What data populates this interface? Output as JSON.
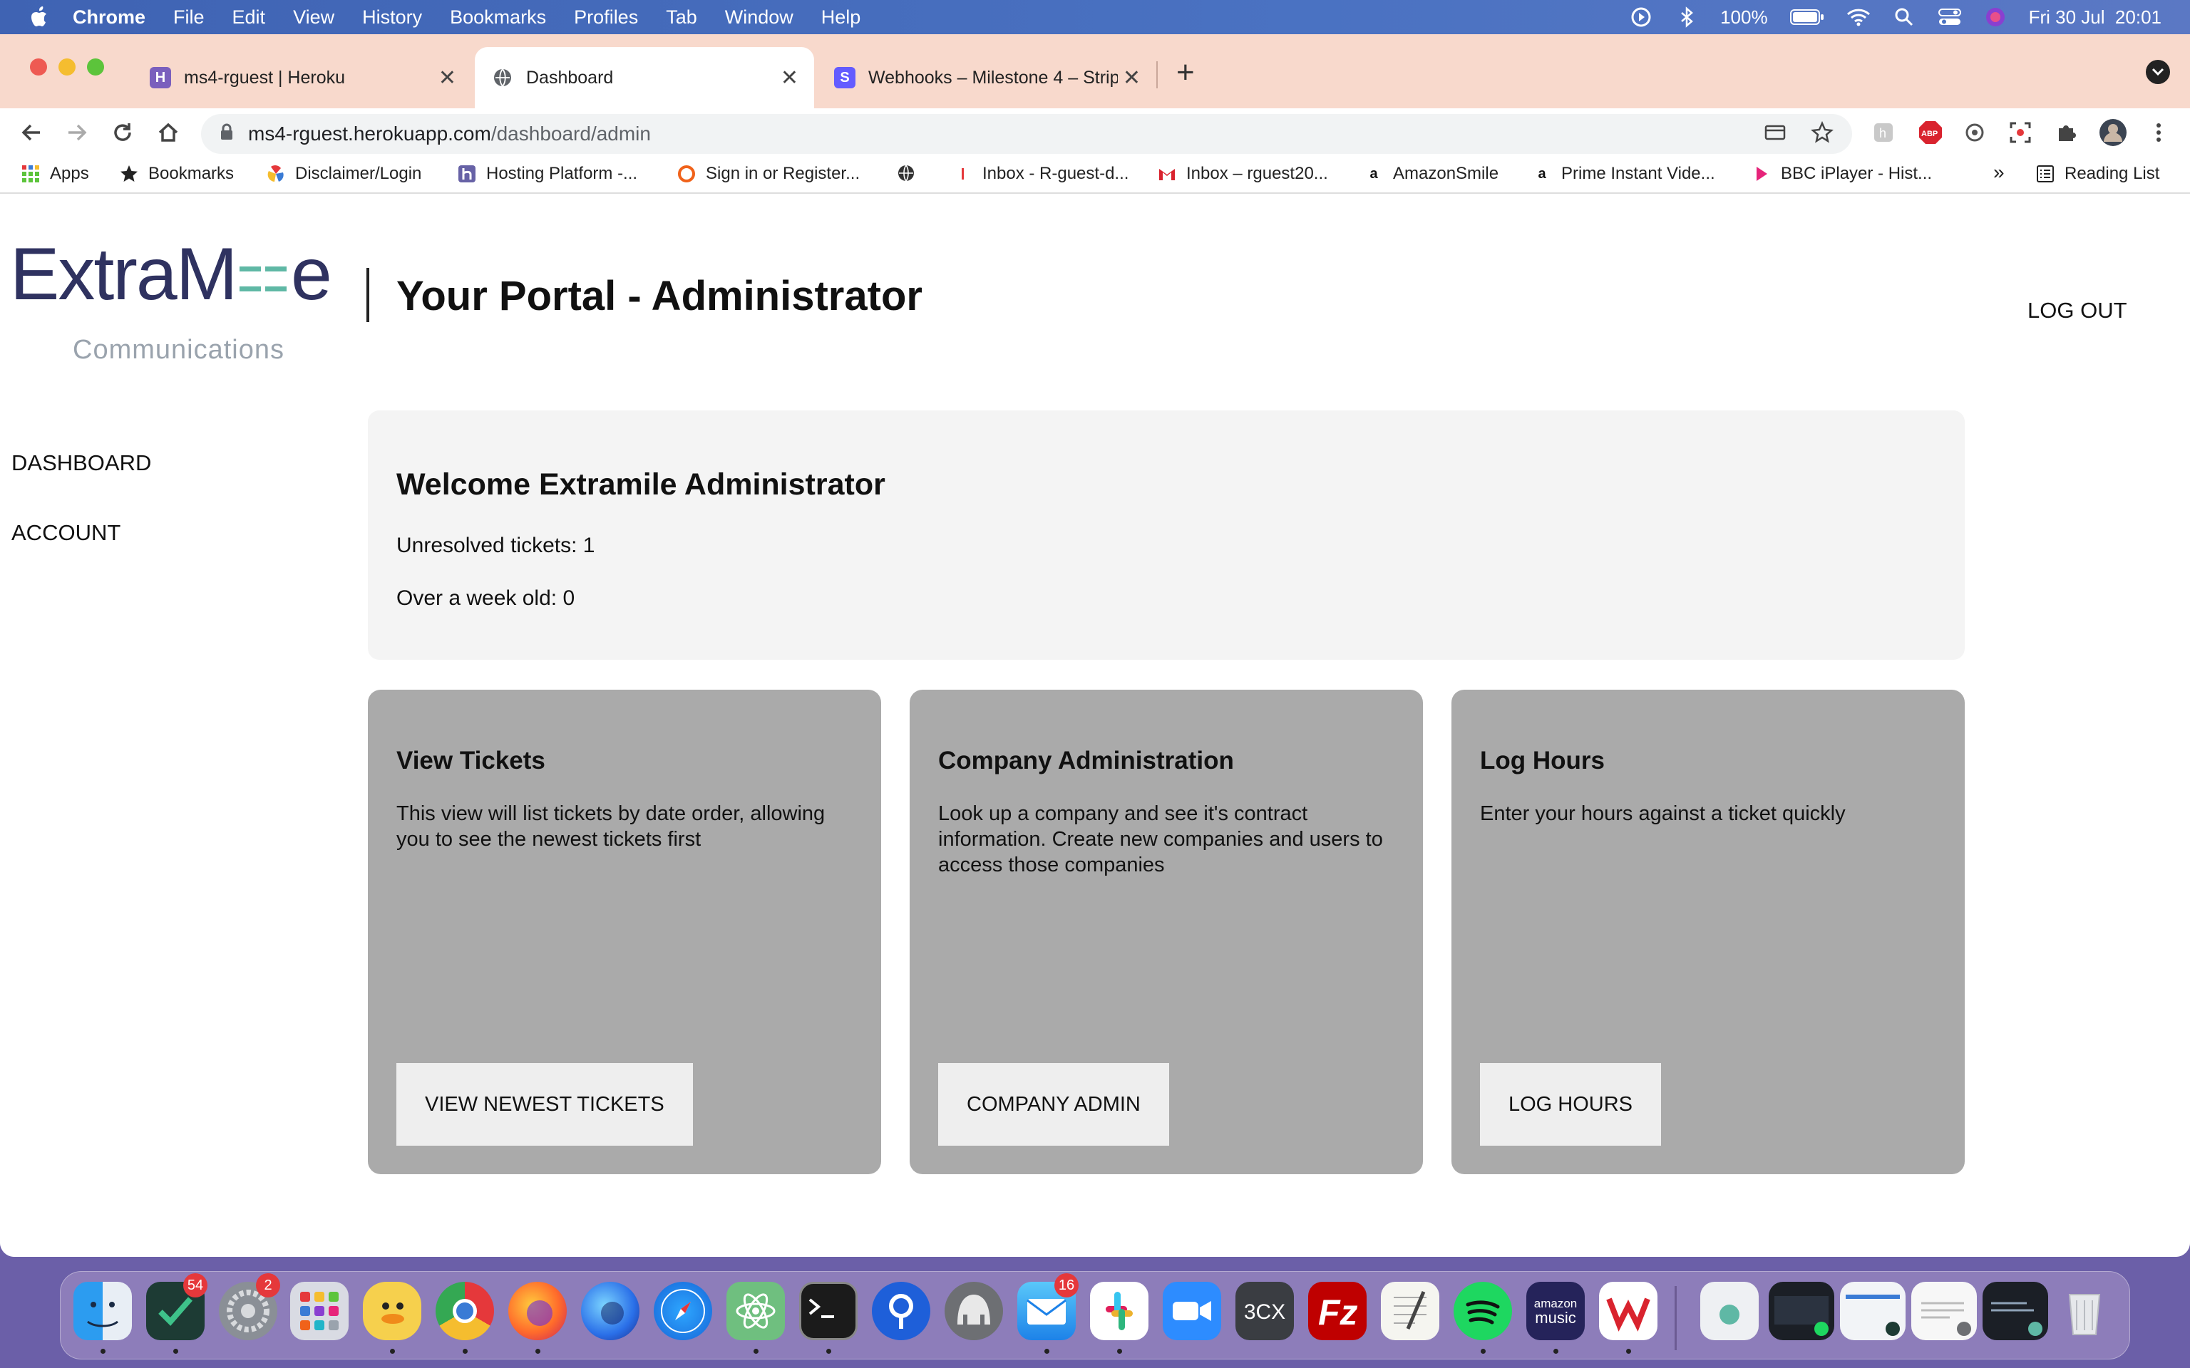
{
  "menubar": {
    "app": "Chrome",
    "items": [
      "File",
      "Edit",
      "View",
      "History",
      "Bookmarks",
      "Profiles",
      "Tab",
      "Window",
      "Help"
    ],
    "battery": "100%",
    "clock": "Fri 30 Jul  20:01"
  },
  "tabs": [
    {
      "title": "ms4-rguest | Heroku",
      "favicon": "H"
    },
    {
      "title": "Dashboard",
      "favicon": "globe"
    },
    {
      "title": "Webhooks – Milestone 4 – Strip",
      "favicon": "S"
    }
  ],
  "omnibox": {
    "host": "ms4-rguest.herokuapp.com",
    "path": "/dashboard/admin"
  },
  "bookmarks": {
    "items": [
      "Apps",
      "Bookmarks",
      "Disclaimer/Login",
      "Hosting Platform -...",
      "Sign in or Register...",
      "",
      "Inbox - R-guest-d...",
      "Inbox – rguest20...",
      "AmazonSmile",
      "Prime Instant Vide...",
      "BBC iPlayer - Hist..."
    ],
    "overflow": "»",
    "reading_list": "Reading List"
  },
  "page": {
    "logo_word": "ExtraM=e",
    "logo_sub": "Communications",
    "title": "Your Portal - Administrator",
    "logout": "LOG OUT",
    "nav": [
      "DASHBOARD",
      "ACCOUNT"
    ],
    "welcome": {
      "heading": "Welcome Extramile Administrator",
      "unresolved": "Unresolved tickets: 1",
      "week_old": "Over a week old: 0"
    },
    "cards": [
      {
        "title": "View Tickets",
        "text": "This view will list tickets by date order, allowing you to see the newest tickets first",
        "button": "VIEW NEWEST TICKETS"
      },
      {
        "title": "Company Administration",
        "text": "Look up a company and see it's contract information. Create new companies and users to access those companies",
        "button": "COMPANY ADMIN"
      },
      {
        "title": "Log Hours",
        "text": "Enter your hours against a ticket quickly",
        "button": "LOG HOURS"
      }
    ]
  },
  "dock": {
    "badges": {
      "things": "54",
      "settings": "2",
      "mail": "16"
    },
    "icons": [
      "finder",
      "things",
      "system-preferences",
      "launchpad",
      "cyberduck",
      "chrome",
      "firefox",
      "firefox-dev",
      "safari",
      "atom",
      "terminal",
      "maps",
      "sequel-pro",
      "mail",
      "slack",
      "zoom",
      "3cx",
      "filezilla",
      "textedit",
      "spotify",
      "amazon-music",
      "wps-office",
      "document",
      "window-1",
      "window-2",
      "window-3",
      "window-4",
      "trash"
    ],
    "labels": {
      "3cx": "3CX",
      "amazon_music": "amazon music"
    }
  }
}
